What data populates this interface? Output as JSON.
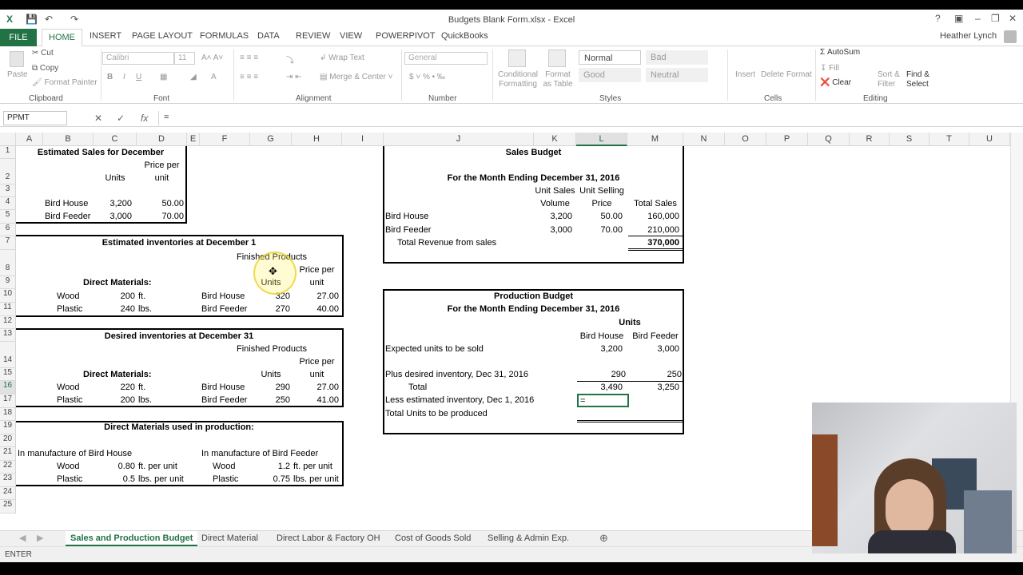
{
  "window": {
    "title": "Budgets Blank Form.xlsx - Excel",
    "user": "Heather Lynch",
    "help": "?"
  },
  "ribbon_tabs": [
    "FILE",
    "HOME",
    "INSERT",
    "PAGE LAYOUT",
    "FORMULAS",
    "DATA",
    "REVIEW",
    "VIEW",
    "POWERPIVOT",
    "QuickBooks"
  ],
  "clipboard": {
    "paste": "Paste",
    "cut": "Cut",
    "copy": "Copy",
    "format_painter": "Format Painter",
    "group": "Clipboard"
  },
  "font": {
    "name": "Calibri",
    "size": "11",
    "group": "Font"
  },
  "alignment": {
    "wrap": "Wrap Text",
    "merge": "Merge & Center",
    "group": "Alignment"
  },
  "number": {
    "format": "General",
    "group": "Number"
  },
  "styles": {
    "cond": "Conditional Formatting",
    "table": "Format as Table",
    "normal": "Normal",
    "bad": "Bad",
    "good": "Good",
    "neutral": "Neutral",
    "group": "Styles"
  },
  "cells": {
    "insert": "Insert",
    "delete": "Delete",
    "format": "Format",
    "group": "Cells"
  },
  "editing": {
    "autosum": "AutoSum",
    "fill": "Fill",
    "clear": "Clear",
    "sort": "Sort & Filter",
    "find": "Find & Select",
    "group": "Editing"
  },
  "formula_bar": {
    "name_box": "PPMT",
    "value": "=",
    "fx": "fx"
  },
  "columns": [
    "A",
    "B",
    "C",
    "D",
    "E",
    "F",
    "G",
    "H",
    "I",
    "J",
    "K",
    "L",
    "M",
    "N",
    "O",
    "P",
    "Q",
    "R",
    "S",
    "T",
    "U"
  ],
  "rows": [
    "1",
    "2",
    "3",
    "4",
    "5",
    "6",
    "7",
    "8",
    "9",
    "10",
    "11",
    "12",
    "13",
    "14",
    "15",
    "16",
    "17",
    "18",
    "19",
    "20",
    "21",
    "22",
    "23",
    "24",
    "25"
  ],
  "cells_data": {
    "t1": "Estimated Sales for December",
    "price_per": "Price per",
    "unit": "unit",
    "units": "Units",
    "bh": "Bird House",
    "bf": "Bird Feeder",
    "bh_units": "3,200",
    "bh_price": "50.00",
    "bf_units": "3,000",
    "bf_price": "70.00",
    "t6": "Estimated inventories at December 1",
    "fin": "Finished Products",
    "dm": "Direct Materials:",
    "wood": "Wood",
    "plastic": "Plastic",
    "w200": "200",
    "ft": "ft.",
    "p240": "240",
    "lbs": "lbs.",
    "g9": "320",
    "h9": "27.00",
    "g10": "270",
    "h10": "40.00",
    "t12": "Desired inventories at December 31",
    "w220": "220",
    "p200": "200",
    "g15": "290",
    "h15": "27.00",
    "g16": "250",
    "h16": "41.00",
    "t18": "Direct Materials used in production:",
    "mbh": "In manufacture of Bird House",
    "mbf": "In manufacture of Bird Feeder",
    "c21": "0.80",
    "d21": "ft. per unit",
    "c22": "0.5",
    "d22": "lbs. per unit",
    "g21": "1.2",
    "h21": "ft. per unit",
    "g22": "0.75",
    "h22": "lbs. per unit",
    "sb_title": "Sales Budget",
    "sb_month": "For the Month Ending December 31, 2016",
    "unit_sales": "Unit Sales",
    "volume": "Volume",
    "unit_selling": "Unit Selling",
    "price": "Price",
    "total_sales": "Total Sales",
    "k4": "3,200",
    "l4": "50.00",
    "m4": "160,000",
    "k5": "3,000",
    "l5": "70.00",
    "m5": "210,000",
    "trev": "Total Revenue from sales",
    "m6": "370,000",
    "pb_title": "Production Budget",
    "pb_month": "For the Month Ending December 31, 2016",
    "pb_units": "Units",
    "pb_bh": "Bird House",
    "pb_bf": "Bird Feeder",
    "exp": "Expected units to be sold",
    "l13": "3,200",
    "m13": "3,000",
    "plus": "Plus desired inventory, Dec 31, 2016",
    "l14": "290",
    "m14": "250",
    "total": "Total",
    "l15": "3,490",
    "m15": "3,250",
    "less": "Less estimated inventory, Dec 1, 2016",
    "l16": "=",
    "tup": "Total Units to be produced"
  },
  "sheet_tabs": [
    "Sales and Production Budget",
    "Direct Material",
    "Direct Labor & Factory OH",
    "Cost of Goods Sold",
    "Selling & Admin Exp."
  ],
  "status": {
    "mode": "ENTER"
  },
  "colors": {
    "excel_green": "#217346"
  }
}
